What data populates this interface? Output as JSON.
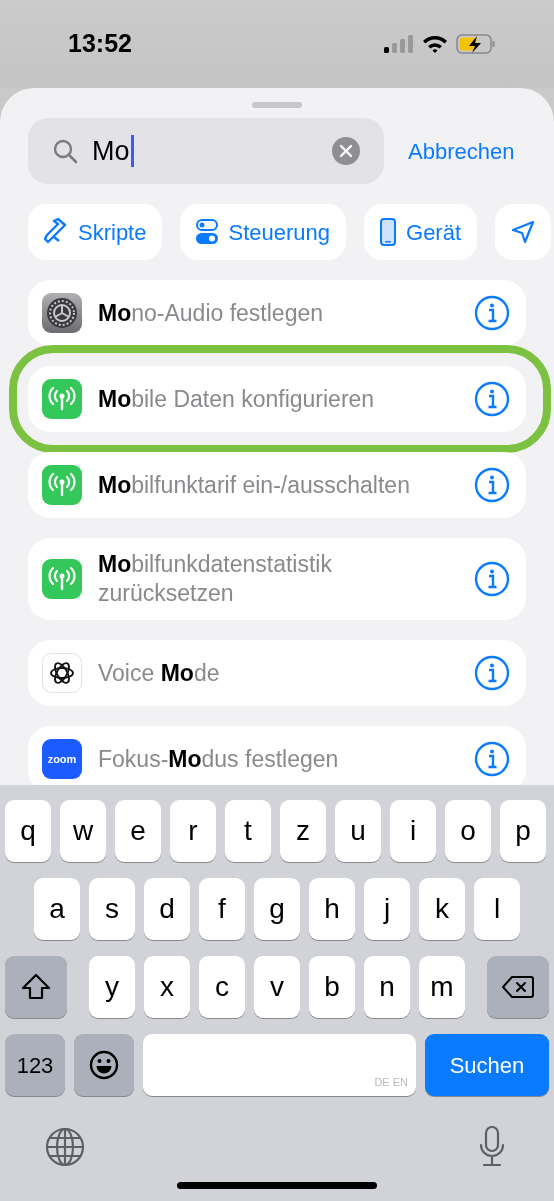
{
  "status_bar": {
    "time": "13:52"
  },
  "search": {
    "value": "Mo",
    "cancel": "Abbrechen"
  },
  "chips": [
    {
      "label": "Skripte",
      "kind": "script"
    },
    {
      "label": "Steuerung",
      "kind": "toggle"
    },
    {
      "label": "Gerät",
      "kind": "phone"
    },
    {
      "kind": "location"
    }
  ],
  "results": [
    {
      "title": "**Mo**no-Audio festlegen",
      "kind": "settings",
      "annotated": false
    },
    {
      "title": "**Mo**bile Daten konfigurieren",
      "kind": "cellular",
      "annotated": true
    },
    {
      "title": "**Mo**bilfunktarif ein-/ausschalten",
      "kind": "cellular",
      "annotated": false
    },
    {
      "title": "**Mo**bilfunkdatenstatistik zurücksetzen",
      "kind": "cellular",
      "annotated": false
    },
    {
      "title": "Voice **Mo**de",
      "kind": "knot",
      "annotated": false
    },
    {
      "title": "Fokus-**Mo**dus festlegen",
      "kind": "app",
      "icon_label": "zoom",
      "annotated": false
    }
  ],
  "keyboard": {
    "rows": [
      [
        "q",
        "w",
        "e",
        "r",
        "t",
        "z",
        "u",
        "i",
        "o",
        "p"
      ],
      [
        "a",
        "s",
        "d",
        "f",
        "g",
        "h",
        "j",
        "k",
        "l"
      ],
      [
        "y",
        "x",
        "c",
        "v",
        "b",
        "n",
        "m"
      ]
    ],
    "numbers_key": "123",
    "language_hint": "DE EN",
    "action_key": "Suchen"
  }
}
